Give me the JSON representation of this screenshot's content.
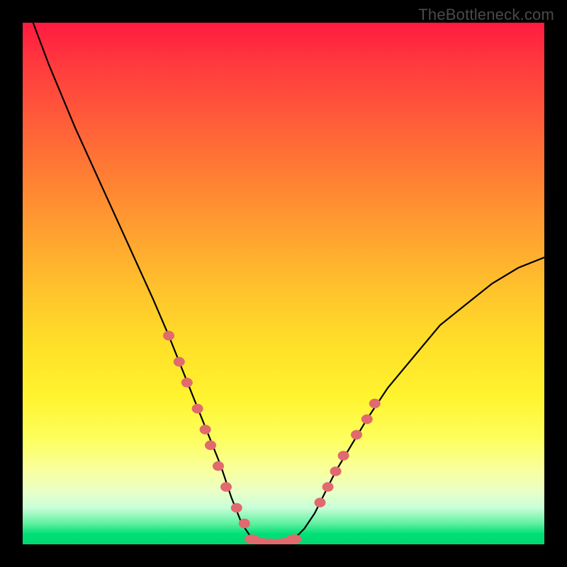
{
  "watermark": "TheBottleneck.com",
  "colors": {
    "background": "#000000",
    "curve_stroke": "#000000",
    "marker_fill": "#e06a6d",
    "gradient_top": "#ff1a40",
    "gradient_bottom": "#00d870"
  },
  "chart_data": {
    "type": "line",
    "title": "",
    "xlabel": "",
    "ylabel": "",
    "xlim": [
      0,
      100
    ],
    "ylim": [
      0,
      100
    ],
    "description": "V-shaped bottleneck curve: y≈100 near x=0, drops to ~0 around x≈42–52, rises to ~55 near x=100. Background gradient maps y high→red, low→green.",
    "series": [
      {
        "name": "bottleneck-curve",
        "x": [
          2,
          5,
          10,
          15,
          20,
          25,
          28,
          30,
          32,
          34,
          36,
          38,
          40,
          42,
          44,
          46,
          48,
          50,
          52,
          54,
          56,
          58,
          60,
          63,
          66,
          70,
          75,
          80,
          85,
          90,
          95,
          100
        ],
        "y": [
          100,
          92,
          80,
          69,
          58,
          47,
          40,
          35,
          30,
          25,
          20,
          15,
          9,
          4,
          1,
          0,
          0,
          0,
          1,
          3,
          6,
          10,
          14,
          19,
          24,
          30,
          36,
          42,
          46,
          50,
          53,
          55
        ]
      }
    ],
    "markers_left": {
      "name": "left-cluster",
      "x": [
        28,
        30,
        31.5,
        33.5,
        35,
        36,
        37.5,
        39,
        41,
        42.5
      ],
      "y": [
        40,
        35,
        31,
        26,
        22,
        19,
        15,
        11,
        7,
        4
      ]
    },
    "markers_bottom": {
      "name": "bottom-cluster",
      "x": [
        44,
        46,
        47.5,
        49,
        50.5,
        52
      ],
      "y": [
        1,
        0.3,
        0.2,
        0.2,
        0.4,
        1
      ]
    },
    "markers_right": {
      "name": "right-cluster",
      "x": [
        57,
        58.5,
        60,
        61.5,
        64,
        66,
        67.5
      ],
      "y": [
        8,
        11,
        14,
        17,
        21,
        24,
        27
      ]
    }
  }
}
